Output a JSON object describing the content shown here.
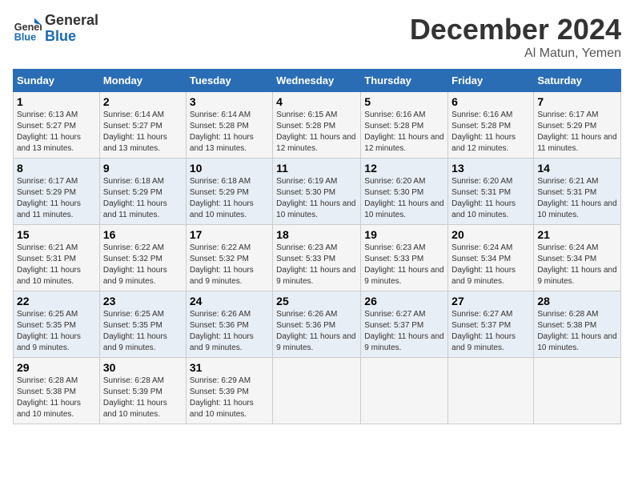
{
  "logo": {
    "line1": "General",
    "line2": "Blue"
  },
  "title": "December 2024",
  "location": "Al Matun, Yemen",
  "days_of_week": [
    "Sunday",
    "Monday",
    "Tuesday",
    "Wednesday",
    "Thursday",
    "Friday",
    "Saturday"
  ],
  "weeks": [
    [
      {
        "day": "1",
        "sunrise": "6:13 AM",
        "sunset": "5:27 PM",
        "daylight": "11 hours and 13 minutes."
      },
      {
        "day": "2",
        "sunrise": "6:14 AM",
        "sunset": "5:27 PM",
        "daylight": "11 hours and 13 minutes."
      },
      {
        "day": "3",
        "sunrise": "6:14 AM",
        "sunset": "5:28 PM",
        "daylight": "11 hours and 13 minutes."
      },
      {
        "day": "4",
        "sunrise": "6:15 AM",
        "sunset": "5:28 PM",
        "daylight": "11 hours and 12 minutes."
      },
      {
        "day": "5",
        "sunrise": "6:16 AM",
        "sunset": "5:28 PM",
        "daylight": "11 hours and 12 minutes."
      },
      {
        "day": "6",
        "sunrise": "6:16 AM",
        "sunset": "5:28 PM",
        "daylight": "11 hours and 12 minutes."
      },
      {
        "day": "7",
        "sunrise": "6:17 AM",
        "sunset": "5:29 PM",
        "daylight": "11 hours and 11 minutes."
      }
    ],
    [
      {
        "day": "8",
        "sunrise": "6:17 AM",
        "sunset": "5:29 PM",
        "daylight": "11 hours and 11 minutes."
      },
      {
        "day": "9",
        "sunrise": "6:18 AM",
        "sunset": "5:29 PM",
        "daylight": "11 hours and 11 minutes."
      },
      {
        "day": "10",
        "sunrise": "6:18 AM",
        "sunset": "5:29 PM",
        "daylight": "11 hours and 10 minutes."
      },
      {
        "day": "11",
        "sunrise": "6:19 AM",
        "sunset": "5:30 PM",
        "daylight": "11 hours and 10 minutes."
      },
      {
        "day": "12",
        "sunrise": "6:20 AM",
        "sunset": "5:30 PM",
        "daylight": "11 hours and 10 minutes."
      },
      {
        "day": "13",
        "sunrise": "6:20 AM",
        "sunset": "5:31 PM",
        "daylight": "11 hours and 10 minutes."
      },
      {
        "day": "14",
        "sunrise": "6:21 AM",
        "sunset": "5:31 PM",
        "daylight": "11 hours and 10 minutes."
      }
    ],
    [
      {
        "day": "15",
        "sunrise": "6:21 AM",
        "sunset": "5:31 PM",
        "daylight": "11 hours and 10 minutes."
      },
      {
        "day": "16",
        "sunrise": "6:22 AM",
        "sunset": "5:32 PM",
        "daylight": "11 hours and 9 minutes."
      },
      {
        "day": "17",
        "sunrise": "6:22 AM",
        "sunset": "5:32 PM",
        "daylight": "11 hours and 9 minutes."
      },
      {
        "day": "18",
        "sunrise": "6:23 AM",
        "sunset": "5:33 PM",
        "daylight": "11 hours and 9 minutes."
      },
      {
        "day": "19",
        "sunrise": "6:23 AM",
        "sunset": "5:33 PM",
        "daylight": "11 hours and 9 minutes."
      },
      {
        "day": "20",
        "sunrise": "6:24 AM",
        "sunset": "5:34 PM",
        "daylight": "11 hours and 9 minutes."
      },
      {
        "day": "21",
        "sunrise": "6:24 AM",
        "sunset": "5:34 PM",
        "daylight": "11 hours and 9 minutes."
      }
    ],
    [
      {
        "day": "22",
        "sunrise": "6:25 AM",
        "sunset": "5:35 PM",
        "daylight": "11 hours and 9 minutes."
      },
      {
        "day": "23",
        "sunrise": "6:25 AM",
        "sunset": "5:35 PM",
        "daylight": "11 hours and 9 minutes."
      },
      {
        "day": "24",
        "sunrise": "6:26 AM",
        "sunset": "5:36 PM",
        "daylight": "11 hours and 9 minutes."
      },
      {
        "day": "25",
        "sunrise": "6:26 AM",
        "sunset": "5:36 PM",
        "daylight": "11 hours and 9 minutes."
      },
      {
        "day": "26",
        "sunrise": "6:27 AM",
        "sunset": "5:37 PM",
        "daylight": "11 hours and 9 minutes."
      },
      {
        "day": "27",
        "sunrise": "6:27 AM",
        "sunset": "5:37 PM",
        "daylight": "11 hours and 9 minutes."
      },
      {
        "day": "28",
        "sunrise": "6:28 AM",
        "sunset": "5:38 PM",
        "daylight": "11 hours and 10 minutes."
      }
    ],
    [
      {
        "day": "29",
        "sunrise": "6:28 AM",
        "sunset": "5:38 PM",
        "daylight": "11 hours and 10 minutes."
      },
      {
        "day": "30",
        "sunrise": "6:28 AM",
        "sunset": "5:39 PM",
        "daylight": "11 hours and 10 minutes."
      },
      {
        "day": "31",
        "sunrise": "6:29 AM",
        "sunset": "5:39 PM",
        "daylight": "11 hours and 10 minutes."
      },
      null,
      null,
      null,
      null
    ]
  ]
}
